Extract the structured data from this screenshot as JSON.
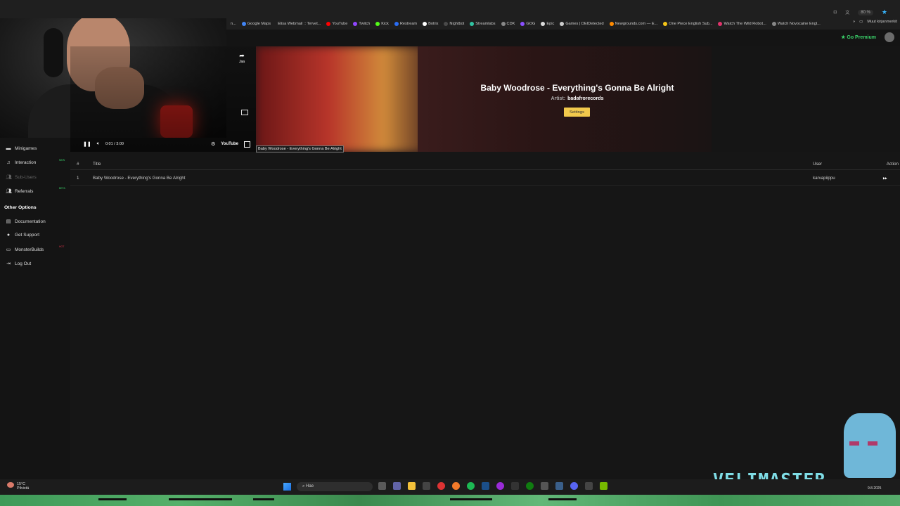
{
  "browser": {
    "zoom": "80 %",
    "bookmarks": [
      {
        "label": "n...",
        "color": ""
      },
      {
        "label": "Google Maps",
        "color": "#4285f4"
      },
      {
        "label": "Elisa Webmail :: Tervet...",
        "color": ""
      },
      {
        "label": "YouTube",
        "color": "#ff0000"
      },
      {
        "label": "Twitch",
        "color": "#9146ff"
      },
      {
        "label": "Kick",
        "color": "#53fc18"
      },
      {
        "label": "Restream",
        "color": "#2a6df4"
      },
      {
        "label": "Botrix",
        "color": "#ffffff"
      },
      {
        "label": "Nightbot",
        "color": "#4a4a4a"
      },
      {
        "label": "Streamlabs",
        "color": "#31c3a2"
      },
      {
        "label": "CDK",
        "color": "#888888"
      },
      {
        "label": "GOG",
        "color": "#8a4fff"
      },
      {
        "label": "Epic",
        "color": "#dddddd"
      },
      {
        "label": "Games | DEIDetected",
        "color": "#cccccc"
      },
      {
        "label": "Newgrounds.com — E...",
        "color": "#ff8a00"
      },
      {
        "label": "One Piece English Sub...",
        "color": "#f5c518"
      },
      {
        "label": "Watch The Wild Robot...",
        "color": "#e0336b"
      },
      {
        "label": "Watch Novocaine Engl...",
        "color": "#888888"
      }
    ],
    "more_bookmarks": "Muut kirjanmerkit",
    "go_premium": "Go Premium"
  },
  "video": {
    "share_label": "Jaa",
    "time": "0:01 / 3:00",
    "brand": "YouTube",
    "tooltip": "Baby Woodrose - Everything's Gonna Be Alright"
  },
  "banner": {
    "title": "Baby Woodrose - Everything's Gonna Be Alright",
    "artist_label": "Artist:",
    "artist": "badafrorecords",
    "settings_label": "Settings"
  },
  "sidebar": {
    "items": [
      {
        "label": "Minigames",
        "icon": "gamepad-icon"
      },
      {
        "label": "Interaction",
        "icon": "music-icon",
        "badge": "NEW"
      },
      {
        "label": "Sub-Users",
        "icon": "users-icon"
      },
      {
        "label": "Referrals",
        "icon": "users-icon",
        "badge": "BETA"
      }
    ],
    "other_title": "Other Options",
    "other_items": [
      {
        "label": "Documentation",
        "icon": "book-icon"
      },
      {
        "label": "Get Support",
        "icon": "help-icon"
      },
      {
        "label": "MonsterBuilds",
        "icon": "monitor-icon",
        "badge": "HOT"
      },
      {
        "label": "Log Out",
        "icon": "logout-icon"
      }
    ]
  },
  "table": {
    "headers": {
      "num": "#",
      "title": "Title",
      "user": "User",
      "action": "Action"
    },
    "rows": [
      {
        "num": "1",
        "title": "Baby Woodrose - Everything's Gonna Be Alright",
        "user": "karvapiippu"
      }
    ]
  },
  "taskbar": {
    "temp": "15°C",
    "weather": "Pilvistä",
    "search_placeholder": "Hae",
    "date": "9.8.2025"
  },
  "overlay": {
    "brand_text": "VELIMASTER"
  },
  "colors": {
    "accent_yellow": "#f2c94c",
    "premium_green": "#3ad26a",
    "new_badge": "#3ad26a",
    "beta_badge": "#3ad26a",
    "hot_badge": "#e0334a"
  }
}
